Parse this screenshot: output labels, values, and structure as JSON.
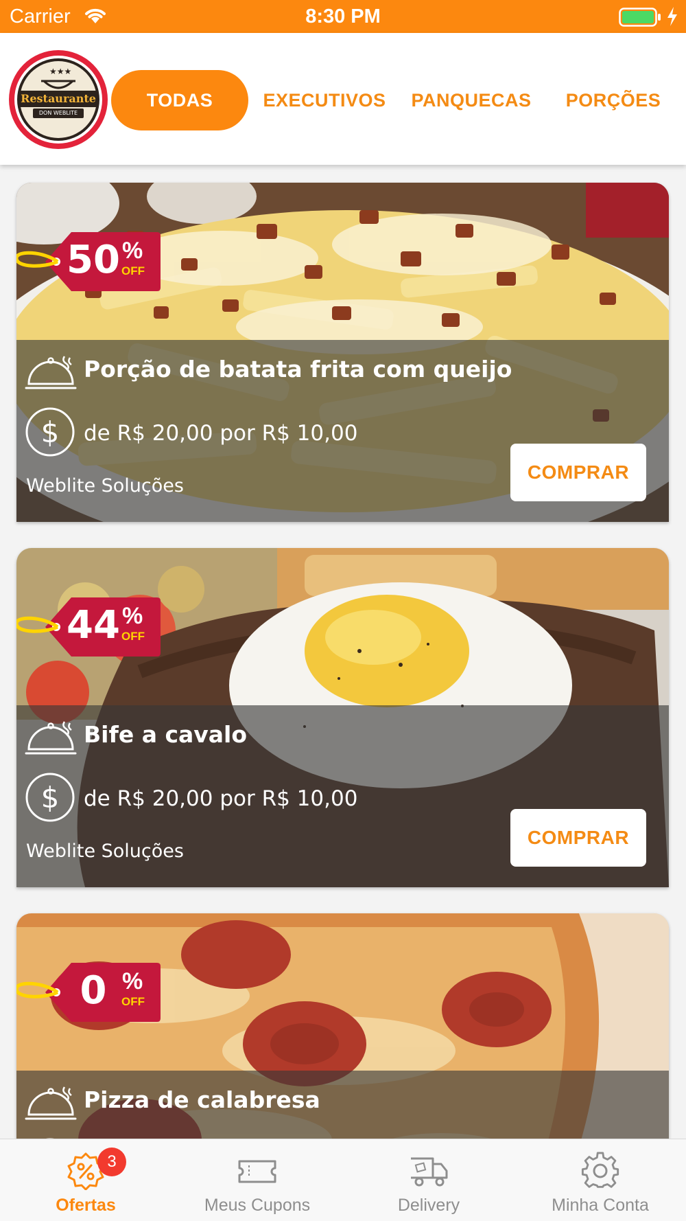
{
  "status_bar": {
    "carrier": "Carrier",
    "time": "8:30 PM",
    "battery_icon": "battery-charging-icon",
    "signal_icon": "wifi-icon"
  },
  "header": {
    "logo": {
      "text_main": "Restaurante",
      "text_sub": "DON WEBLITE"
    },
    "tabs": [
      {
        "label": "TODAS",
        "active": true
      },
      {
        "label": "EXECUTIVOS",
        "active": false
      },
      {
        "label": "PANQUECAS",
        "active": false
      },
      {
        "label": "PORÇÕES",
        "active": false
      }
    ]
  },
  "offers": [
    {
      "discount_value": "50",
      "discount_percent": "%",
      "discount_off": "OFF",
      "name": "Porção de batata frita com queijo",
      "price": "de R$ 20,00 por R$ 10,00",
      "seller": "Weblite Soluções",
      "buy_label": "COMPRAR",
      "photo": "fries-with-cheese-and-bacon"
    },
    {
      "discount_value": "44",
      "discount_percent": "%",
      "discount_off": "OFF",
      "name": "Bife a cavalo",
      "price": "de R$ 20,00 por R$ 10,00",
      "seller": "Weblite Soluções",
      "buy_label": "COMPRAR",
      "photo": "steak-with-fried-egg"
    },
    {
      "discount_value": "0",
      "discount_percent": "%",
      "discount_off": "OFF",
      "name": "Pizza de calabresa",
      "photo": "pepperoni-pizza"
    }
  ],
  "tabbar": {
    "items": [
      {
        "label": "Ofertas",
        "icon": "discount-badge-icon",
        "active": true,
        "badge": "3"
      },
      {
        "label": "Meus Cupons",
        "icon": "ticket-icon",
        "active": false
      },
      {
        "label": "Delivery",
        "icon": "delivery-truck-icon",
        "active": false
      },
      {
        "label": "Minha Conta",
        "icon": "gear-icon",
        "active": false
      }
    ]
  },
  "colors": {
    "accent": "#fc880f",
    "tag": "#c4183c",
    "tag_off": "#ffd400",
    "badge": "#f23a2e"
  }
}
